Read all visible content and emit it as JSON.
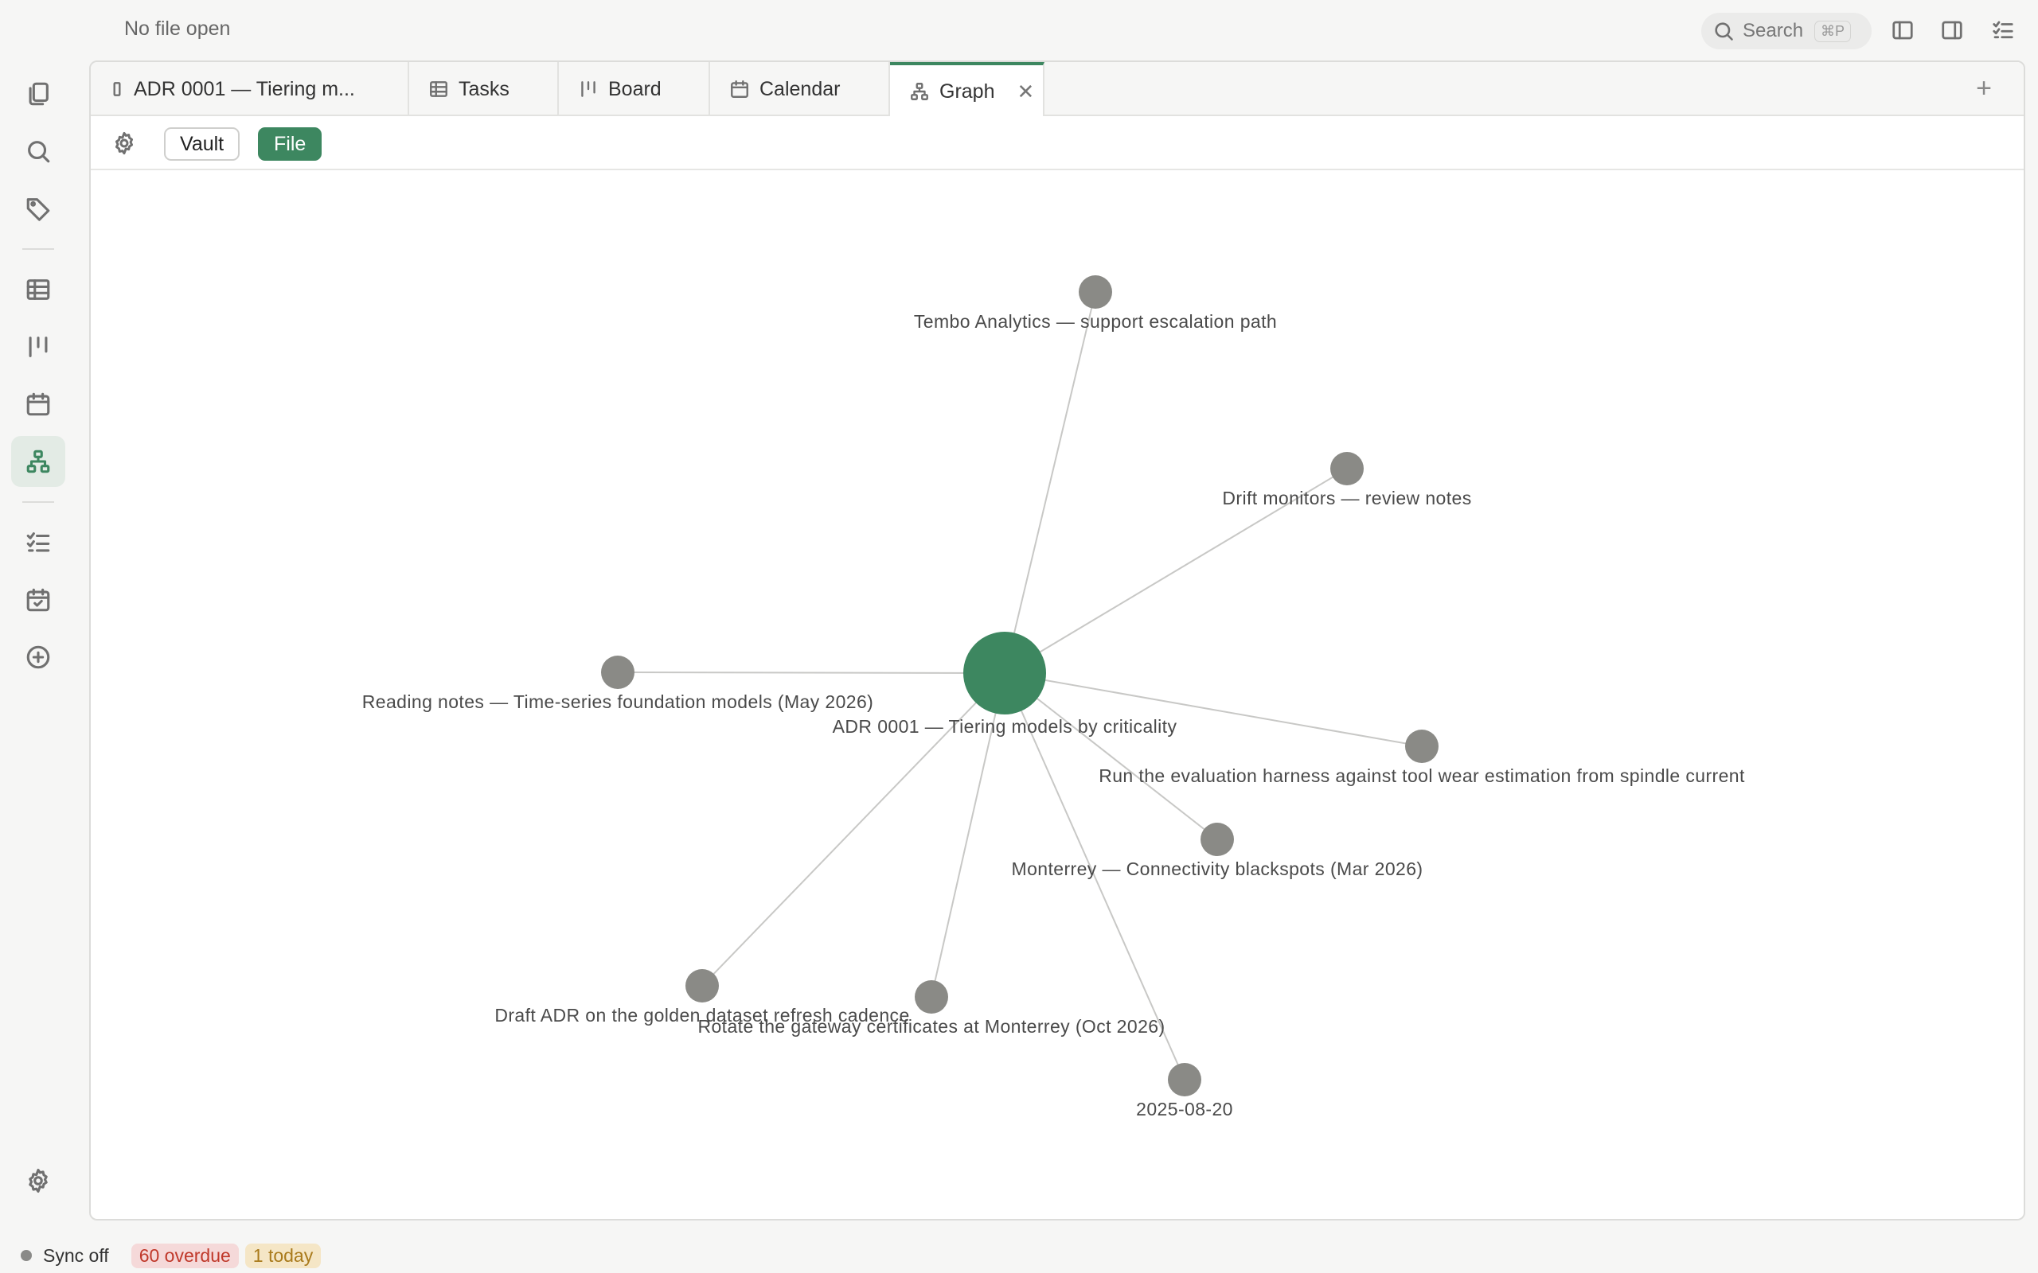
{
  "titlebar": {
    "file_title": "No file open",
    "search_label": "Search",
    "search_shortcut": "⌘P"
  },
  "tabs": [
    {
      "label": "ADR 0001 — Tiering m...",
      "icon": "file-icon"
    },
    {
      "label": "Tasks",
      "icon": "table-icon"
    },
    {
      "label": "Board",
      "icon": "board-icon"
    },
    {
      "label": "Calendar",
      "icon": "calendar-icon"
    },
    {
      "label": "Graph",
      "icon": "graph-icon",
      "active": true
    }
  ],
  "toolbar": {
    "vault_label": "Vault",
    "file_label": "File",
    "active_mode": "File"
  },
  "graph": {
    "center": {
      "label": "ADR 0001 — Tiering models by criticality",
      "color": "#3d8760"
    },
    "nodes": [
      {
        "label": "Tembo Analytics — support escalation path"
      },
      {
        "label": "Drift monitors — review notes"
      },
      {
        "label": "Reading notes — Time-series foundation models (May 2026)"
      },
      {
        "label": "Run the evaluation harness against tool wear estimation from spindle current"
      },
      {
        "label": "Monterrey — Connectivity blackspots (Mar 2026)"
      },
      {
        "label": "Draft ADR on the golden dataset refresh cadence"
      },
      {
        "label": "Rotate the gateway certificates at Monterrey (Oct 2026)"
      },
      {
        "label": "2025-08-20"
      }
    ],
    "node_color": "#8a8a86",
    "edge_color": "#c8c8c6"
  },
  "statusbar": {
    "sync_label": "Sync off",
    "overdue_label": "60 overdue",
    "today_label": "1 today"
  },
  "colors": {
    "accent": "#3d8760",
    "overdue_bg": "#f5d9d9",
    "overdue_fg": "#c0392b",
    "today_bg": "#f5e6c6",
    "today_fg": "#a97a1b"
  }
}
